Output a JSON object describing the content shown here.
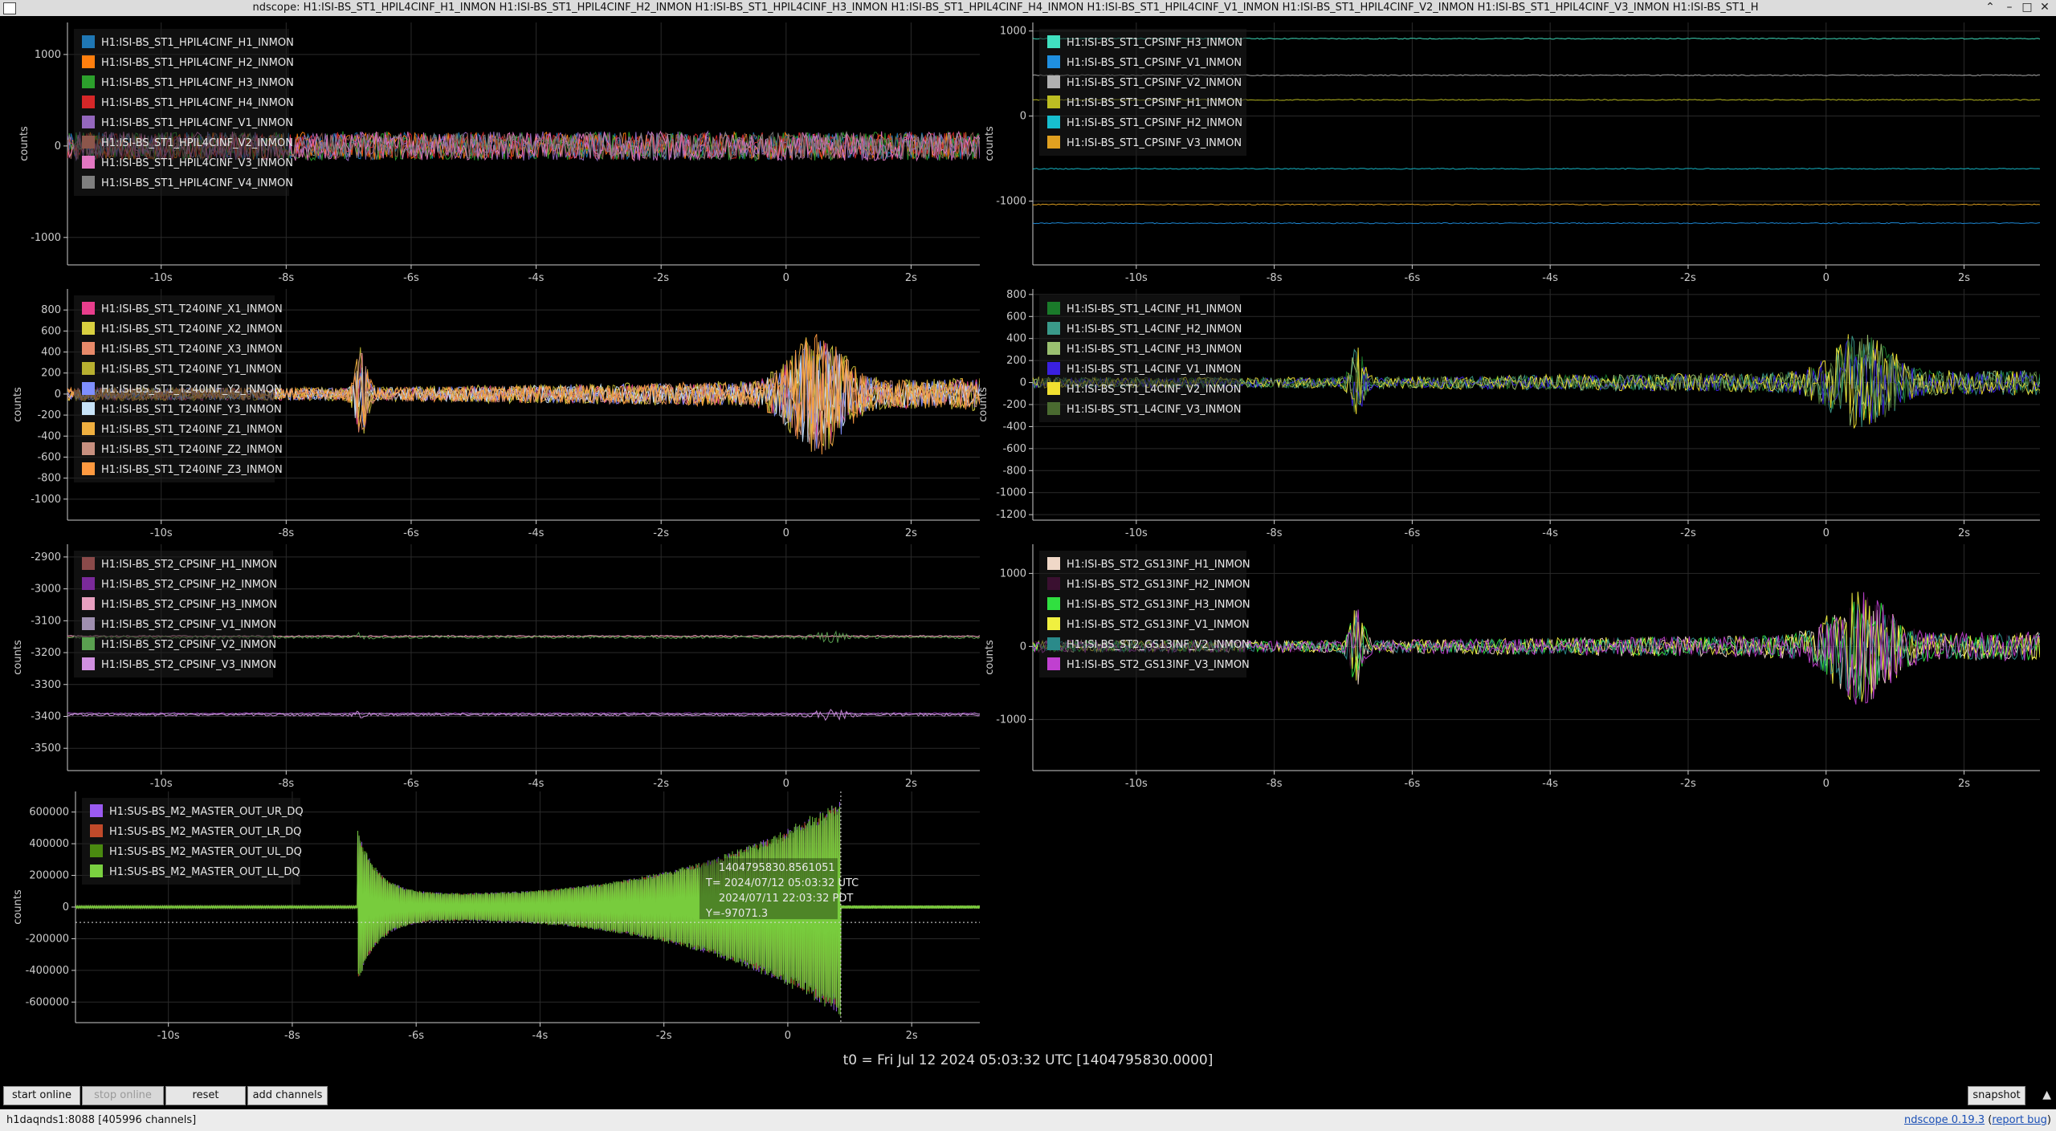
{
  "window": {
    "title": "ndscope: H1:ISI-BS_ST1_HPIL4CINF_H1_INMON H1:ISI-BS_ST1_HPIL4CINF_H2_INMON H1:ISI-BS_ST1_HPIL4CINF_H3_INMON H1:ISI-BS_ST1_HPIL4CINF_H4_INMON H1:ISI-BS_ST1_HPIL4CINF_V1_INMON H1:ISI-BS_ST1_HPIL4CINF_V2_INMON H1:ISI-BS_ST1_HPIL4CINF_V3_INMON H1:ISI-BS_ST1_H",
    "controls": [
      "⌃",
      "–",
      "□",
      "✕"
    ]
  },
  "t0_label": "t0 = Fri Jul 12 2024 05:03:32 UTC [1404795830.0000]",
  "toolbar": {
    "start_online": "start online",
    "stop_online": "stop online",
    "reset": "reset",
    "add_channels": "add channels",
    "snapshot": "snapshot"
  },
  "status": {
    "server": "h1daqnds1:8088  [405996 channels]",
    "version_link": "ndscope 0.19.3",
    "report_bug": "report bug"
  },
  "cursor": {
    "line1": "1404795830.8561051",
    "line2": "T= 2024/07/12 05:03:32 UTC",
    "line3": "2024/07/11 22:03:32 PDT",
    "line4": "Y=-97071.3",
    "t": 0.856,
    "y": -97071.3
  },
  "colors": {
    "background": "#000000",
    "grid": "#2a2a2a",
    "axis": "#cccccc",
    "legend_bg": "#1e1e1e"
  },
  "chart_data": [
    {
      "type": "line",
      "id": "p1",
      "ylabel": "counts",
      "xlim": [
        -11.5,
        3.1
      ],
      "ylim": [
        -1300,
        1350
      ],
      "xticks": [
        -10,
        -8,
        -6,
        -4,
        -2,
        0,
        2
      ],
      "xtick_labels": [
        "-10s",
        "-8s",
        "-6s",
        "-4s",
        "-2s",
        "0",
        "2s"
      ],
      "yticks": [
        -1000,
        0,
        1000
      ],
      "ytick_labels": [
        "-1000",
        "0",
        "1000"
      ],
      "series": [
        {
          "name": "H1:ISI-BS_ST1_HPIL4CINF_H1_INMON",
          "color": "#1f77b4",
          "profile": "noise",
          "offset": 0,
          "amp": 150,
          "seed": 1
        },
        {
          "name": "H1:ISI-BS_ST1_HPIL4CINF_H2_INMON",
          "color": "#ff7f0e",
          "profile": "noise",
          "offset": 0,
          "amp": 150,
          "seed": 2
        },
        {
          "name": "H1:ISI-BS_ST1_HPIL4CINF_H3_INMON",
          "color": "#2ca02c",
          "profile": "noise",
          "offset": 0,
          "amp": 160,
          "seed": 3
        },
        {
          "name": "H1:ISI-BS_ST1_HPIL4CINF_H4_INMON",
          "color": "#d62728",
          "profile": "noise",
          "offset": 0,
          "amp": 150,
          "seed": 4
        },
        {
          "name": "H1:ISI-BS_ST1_HPIL4CINF_V1_INMON",
          "color": "#9467bd",
          "profile": "noise",
          "offset": 0,
          "amp": 160,
          "seed": 5
        },
        {
          "name": "H1:ISI-BS_ST1_HPIL4CINF_V2_INMON",
          "color": "#8c564b",
          "profile": "noise",
          "offset": 0,
          "amp": 150,
          "seed": 6
        },
        {
          "name": "H1:ISI-BS_ST1_HPIL4CINF_V3_INMON",
          "color": "#e377c2",
          "profile": "noise",
          "offset": 0,
          "amp": 160,
          "seed": 7
        },
        {
          "name": "H1:ISI-BS_ST1_HPIL4CINF_V4_INMON",
          "color": "#7f7f7f",
          "profile": "noise",
          "offset": 0,
          "amp": 150,
          "seed": 8
        }
      ]
    },
    {
      "type": "line",
      "id": "p2",
      "ylabel": "counts",
      "xlim": [
        -11.5,
        3.1
      ],
      "ylim": [
        -1750,
        1100
      ],
      "xticks": [
        -10,
        -8,
        -6,
        -4,
        -2,
        0,
        2
      ],
      "xtick_labels": [
        "-10s",
        "-8s",
        "-6s",
        "-4s",
        "-2s",
        "0",
        "2s"
      ],
      "yticks": [
        -1000,
        0,
        1000
      ],
      "ytick_labels": [
        "-1000",
        "0",
        "1000"
      ],
      "series": [
        {
          "name": "H1:ISI-BS_ST1_CPSINF_H3_INMON",
          "color": "#40e0c0",
          "profile": "flat",
          "offset": 910,
          "amp": 6,
          "seed": 11
        },
        {
          "name": "H1:ISI-BS_ST1_CPSINF_V1_INMON",
          "color": "#1f8fe0",
          "profile": "flat",
          "offset": -1260,
          "amp": 6,
          "seed": 12
        },
        {
          "name": "H1:ISI-BS_ST1_CPSINF_V2_INMON",
          "color": "#b0b0b0",
          "profile": "flat",
          "offset": 480,
          "amp": 6,
          "seed": 13
        },
        {
          "name": "H1:ISI-BS_ST1_CPSINF_H1_INMON",
          "color": "#bcbd22",
          "profile": "flat",
          "offset": 190,
          "amp": 6,
          "seed": 14
        },
        {
          "name": "H1:ISI-BS_ST1_CPSINF_H2_INMON",
          "color": "#17becf",
          "profile": "flat",
          "offset": -620,
          "amp": 6,
          "seed": 15
        },
        {
          "name": "H1:ISI-BS_ST1_CPSINF_V3_INMON",
          "color": "#e0a020",
          "profile": "flat",
          "offset": -1040,
          "amp": 6,
          "seed": 16
        }
      ]
    },
    {
      "type": "line",
      "id": "p3",
      "ylabel": "counts",
      "xlim": [
        -11.5,
        3.1
      ],
      "ylim": [
        -1200,
        1000
      ],
      "xticks": [
        -10,
        -8,
        -6,
        -4,
        -2,
        0,
        2
      ],
      "xtick_labels": [
        "-10s",
        "-8s",
        "-6s",
        "-4s",
        "-2s",
        "0",
        "2s"
      ],
      "yticks": [
        -1000,
        -800,
        -600,
        -400,
        -200,
        0,
        200,
        400,
        600,
        800
      ],
      "ytick_labels": [
        "-1000",
        "-800",
        "-600",
        "-400",
        "-200",
        "0",
        "200",
        "400",
        "600",
        "800"
      ],
      "series": [
        {
          "name": "H1:ISI-BS_ST1_T240INF_X1_INMON",
          "color": "#e83e8c",
          "profile": "quake",
          "offset": 0,
          "amp": 500,
          "seed": 21
        },
        {
          "name": "H1:ISI-BS_ST1_T240INF_X2_INMON",
          "color": "#d9d040",
          "profile": "quake",
          "offset": 0,
          "amp": 550,
          "seed": 22
        },
        {
          "name": "H1:ISI-BS_ST1_T240INF_X3_INMON",
          "color": "#e88a6a",
          "profile": "quake",
          "offset": 0,
          "amp": 480,
          "seed": 23
        },
        {
          "name": "H1:ISI-BS_ST1_T240INF_Y1_INMON",
          "color": "#b8b030",
          "profile": "quake",
          "offset": 0,
          "amp": 520,
          "seed": 24
        },
        {
          "name": "H1:ISI-BS_ST1_T240INF_Y2_INMON",
          "color": "#7f8fff",
          "profile": "quake",
          "offset": 0,
          "amp": 500,
          "seed": 25
        },
        {
          "name": "H1:ISI-BS_ST1_T240INF_Y3_INMON",
          "color": "#c8e4f8",
          "profile": "quake",
          "offset": 0,
          "amp": 480,
          "seed": 26
        },
        {
          "name": "H1:ISI-BS_ST1_T240INF_Z1_INMON",
          "color": "#f0b040",
          "profile": "quake",
          "offset": 0,
          "amp": 500,
          "seed": 27
        },
        {
          "name": "H1:ISI-BS_ST1_T240INF_Z2_INMON",
          "color": "#c89080",
          "profile": "quake",
          "offset": 0,
          "amp": 500,
          "seed": 28
        },
        {
          "name": "H1:ISI-BS_ST1_T240INF_Z3_INMON",
          "color": "#ff9a40",
          "profile": "quake",
          "offset": 0,
          "amp": 520,
          "seed": 29
        }
      ]
    },
    {
      "type": "line",
      "id": "p4",
      "ylabel": "counts",
      "xlim": [
        -11.5,
        3.1
      ],
      "ylim": [
        -1250,
        850
      ],
      "xticks": [
        -10,
        -8,
        -6,
        -4,
        -2,
        0,
        2
      ],
      "xtick_labels": [
        "-10s",
        "-8s",
        "-6s",
        "-4s",
        "-2s",
        "0",
        "2s"
      ],
      "yticks": [
        -1200,
        -1000,
        -800,
        -600,
        -400,
        -200,
        0,
        200,
        400,
        600,
        800
      ],
      "ytick_labels": [
        "-1200",
        "-1000",
        "-800",
        "-600",
        "-400",
        "-200",
        "0",
        "200",
        "400",
        "600",
        "800"
      ],
      "series": [
        {
          "name": "H1:ISI-BS_ST1_L4CINF_H1_INMON",
          "color": "#1a7a2a",
          "profile": "quake",
          "offset": 0,
          "amp": 380,
          "seed": 31
        },
        {
          "name": "H1:ISI-BS_ST1_L4CINF_H2_INMON",
          "color": "#3a9a8a",
          "profile": "quake",
          "offset": 0,
          "amp": 400,
          "seed": 32
        },
        {
          "name": "H1:ISI-BS_ST1_L4CINF_H3_INMON",
          "color": "#9ac070",
          "profile": "quake",
          "offset": 0,
          "amp": 400,
          "seed": 33
        },
        {
          "name": "H1:ISI-BS_ST1_L4CINF_V1_INMON",
          "color": "#3a20e0",
          "profile": "quake",
          "offset": 0,
          "amp": 380,
          "seed": 34
        },
        {
          "name": "H1:ISI-BS_ST1_L4CINF_V2_INMON",
          "color": "#f0e030",
          "profile": "quake",
          "offset": 0,
          "amp": 420,
          "seed": 35
        },
        {
          "name": "H1:ISI-BS_ST1_L4CINF_V3_INMON",
          "color": "#4a6a30",
          "profile": "quake",
          "offset": 0,
          "amp": 380,
          "seed": 36
        }
      ]
    },
    {
      "type": "line",
      "id": "p5",
      "ylabel": "counts",
      "xlim": [
        -11.5,
        3.1
      ],
      "ylim": [
        -3570,
        -2860
      ],
      "xticks": [
        -10,
        -8,
        -6,
        -4,
        -2,
        0,
        2
      ],
      "xtick_labels": [
        "-10s",
        "-8s",
        "-6s",
        "-4s",
        "-2s",
        "0",
        "2s"
      ],
      "yticks": [
        -3500,
        -3400,
        -3300,
        -3200,
        -3100,
        -3000,
        -2900
      ],
      "ytick_labels": [
        "-3500",
        "-3400",
        "-3300",
        "-3200",
        "-3100",
        "-3000",
        "-2900"
      ],
      "series": [
        {
          "name": "H1:ISI-BS_ST2_CPSINF_H1_INMON",
          "color": "#8a4a4a",
          "profile": "flat",
          "offset": -3150,
          "amp": 2,
          "seed": 41
        },
        {
          "name": "H1:ISI-BS_ST2_CPSINF_H2_INMON",
          "color": "#7a2a9a",
          "profile": "flat",
          "offset": -3390,
          "amp": 2,
          "seed": 42
        },
        {
          "name": "H1:ISI-BS_ST2_CPSINF_H3_INMON",
          "color": "#e8a0c0",
          "profile": "flat",
          "offset": -3148,
          "amp": 2,
          "seed": 43
        },
        {
          "name": "H1:ISI-BS_ST2_CPSINF_V1_INMON",
          "color": "#a090b0",
          "profile": "flat",
          "offset": -3392,
          "amp": 2,
          "seed": 44
        },
        {
          "name": "H1:ISI-BS_ST2_CPSINF_V2_INMON",
          "color": "#5aa050",
          "profile": "flatquake",
          "offset": -3152,
          "amp": 4,
          "seed": 45
        },
        {
          "name": "H1:ISI-BS_ST2_CPSINF_V3_INMON",
          "color": "#d090e0",
          "profile": "flatquake",
          "offset": -3395,
          "amp": 4,
          "seed": 46
        }
      ]
    },
    {
      "type": "line",
      "id": "p6",
      "ylabel": "counts",
      "xlim": [
        -11.5,
        3.1
      ],
      "ylim": [
        -1700,
        1400
      ],
      "xticks": [
        -10,
        -8,
        -6,
        -4,
        -2,
        0,
        2
      ],
      "xtick_labels": [
        "-10s",
        "-8s",
        "-6s",
        "-4s",
        "-2s",
        "0",
        "2s"
      ],
      "yticks": [
        -1000,
        0,
        1000
      ],
      "ytick_labels": [
        "-1000",
        "0",
        "1000"
      ],
      "series": [
        {
          "name": "H1:ISI-BS_ST2_GS13INF_H1_INMON",
          "color": "#f0d8c8",
          "profile": "quake",
          "offset": 0,
          "amp": 700,
          "seed": 51
        },
        {
          "name": "H1:ISI-BS_ST2_GS13INF_H2_INMON",
          "color": "#3a1030",
          "profile": "quake",
          "offset": 0,
          "amp": 650,
          "seed": 52
        },
        {
          "name": "H1:ISI-BS_ST2_GS13INF_H3_INMON",
          "color": "#30e040",
          "profile": "quake",
          "offset": 0,
          "amp": 650,
          "seed": 53
        },
        {
          "name": "H1:ISI-BS_ST2_GS13INF_V1_INMON",
          "color": "#f0f040",
          "profile": "quake",
          "offset": 0,
          "amp": 700,
          "seed": 54
        },
        {
          "name": "H1:ISI-BS_ST2_GS13INF_V2_INMON",
          "color": "#2a8a8a",
          "profile": "quake",
          "offset": 0,
          "amp": 650,
          "seed": 55
        },
        {
          "name": "H1:ISI-BS_ST2_GS13INF_V3_INMON",
          "color": "#c040d0",
          "profile": "quake",
          "offset": 0,
          "amp": 700,
          "seed": 56
        }
      ]
    },
    {
      "type": "line",
      "id": "p7",
      "ylabel": "counts",
      "xlim": [
        -11.5,
        3.1
      ],
      "ylim": [
        -730000,
        730000
      ],
      "xticks": [
        -10,
        -8,
        -6,
        -4,
        -2,
        0,
        2
      ],
      "xtick_labels": [
        "-10s",
        "-8s",
        "-6s",
        "-4s",
        "-2s",
        "0",
        "2s"
      ],
      "yticks": [
        -600000,
        -400000,
        -200000,
        0,
        200000,
        400000,
        600000
      ],
      "ytick_labels": [
        "-600000",
        "-400000",
        "-200000",
        "0",
        "200000",
        "400000",
        "600000"
      ],
      "series": [
        {
          "name": "H1:SUS-BS_M2_MASTER_OUT_UR_DQ",
          "color": "#9a5af0",
          "profile": "ring",
          "offset": 0,
          "amp": 680000,
          "seed": 61
        },
        {
          "name": "H1:SUS-BS_M2_MASTER_OUT_LR_DQ",
          "color": "#c04a2a",
          "profile": "ring",
          "offset": 0,
          "amp": 660000,
          "seed": 62
        },
        {
          "name": "H1:SUS-BS_M2_MASTER_OUT_UL_DQ",
          "color": "#4a8a10",
          "profile": "ring",
          "offset": 0,
          "amp": 660000,
          "seed": 63
        },
        {
          "name": "H1:SUS-BS_M2_MASTER_OUT_LL_DQ",
          "color": "#7ad040",
          "profile": "ring",
          "offset": 0,
          "amp": 690000,
          "seed": 64
        }
      ]
    }
  ]
}
